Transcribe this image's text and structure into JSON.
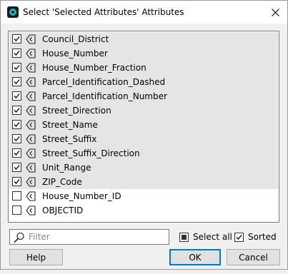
{
  "window": {
    "title": "Select 'Selected Attributes' Attributes"
  },
  "fields": [
    {
      "name": "Council_District",
      "checked": true,
      "highlighted": true
    },
    {
      "name": "House_Number",
      "checked": true,
      "highlighted": true
    },
    {
      "name": "House_Number_Fraction",
      "checked": true,
      "highlighted": true
    },
    {
      "name": "Parcel_Identification_Dashed",
      "checked": true,
      "highlighted": true
    },
    {
      "name": "Parcel_Identification_Number",
      "checked": true,
      "highlighted": true
    },
    {
      "name": "Street_Direction",
      "checked": true,
      "highlighted": true
    },
    {
      "name": "Street_Name",
      "checked": true,
      "highlighted": true
    },
    {
      "name": "Street_Suffix",
      "checked": true,
      "highlighted": true
    },
    {
      "name": "Street_Suffix_Direction",
      "checked": true,
      "highlighted": true
    },
    {
      "name": "Unit_Range",
      "checked": true,
      "highlighted": true
    },
    {
      "name": "ZIP_Code",
      "checked": true,
      "highlighted": true
    },
    {
      "name": "House_Number_ID",
      "checked": false,
      "highlighted": false
    },
    {
      "name": "OBJECTID",
      "checked": false,
      "highlighted": false
    }
  ],
  "filter": {
    "placeholder": "Filter",
    "value": ""
  },
  "options": {
    "select_all_label": "Select all",
    "select_all_state": "indeterminate",
    "sorted_label": "Sorted",
    "sorted_checked": true
  },
  "buttons": {
    "help": "Help",
    "ok": "OK",
    "cancel": "Cancel"
  }
}
